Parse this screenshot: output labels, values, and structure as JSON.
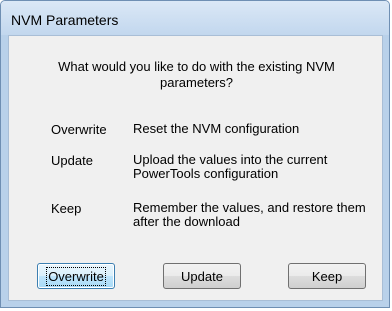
{
  "window": {
    "title": "NVM Parameters"
  },
  "dialog": {
    "question_line1": "What would you like to do with the existing NVM",
    "question_line2": "parameters?",
    "options": [
      {
        "name": "Overwrite",
        "desc_line1": "Reset the NVM configuration",
        "desc_line2": ""
      },
      {
        "name": "Update",
        "desc_line1": "Upload the values into the current",
        "desc_line2": "PowerTools configuration"
      },
      {
        "name": "Keep",
        "desc_line1": "Remember the values, and restore them",
        "desc_line2": "after the download"
      }
    ]
  },
  "buttons": {
    "overwrite": "Overwrite",
    "update": "Update",
    "keep": "Keep"
  }
}
